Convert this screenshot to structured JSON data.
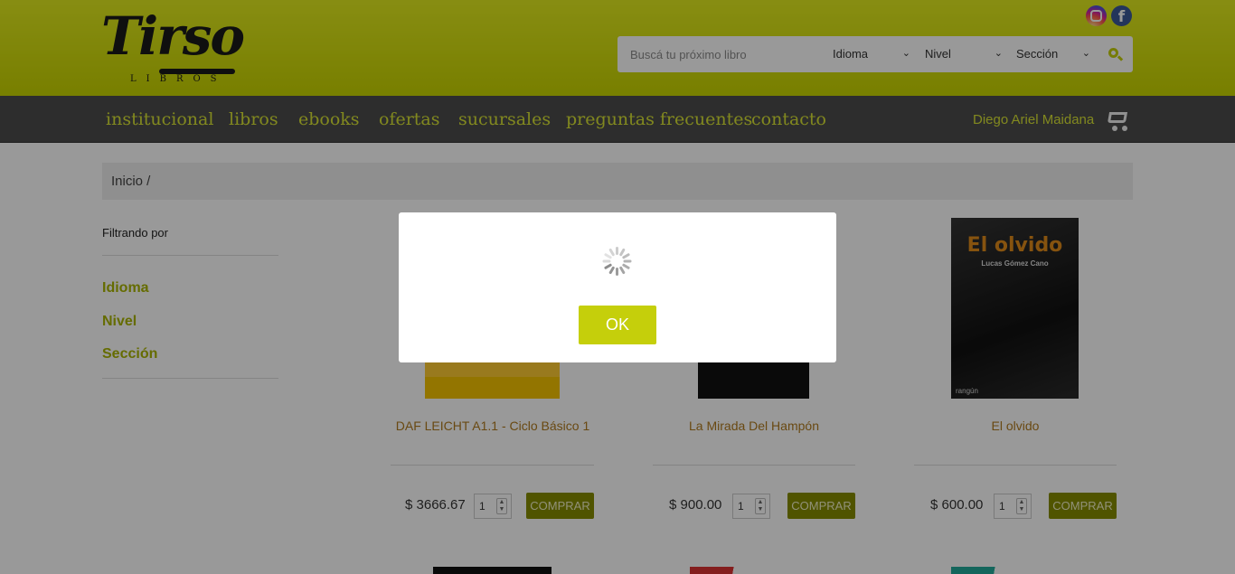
{
  "header": {
    "logo_text": "Tirso",
    "logo_sub": "LIBROS",
    "search": {
      "placeholder": "Buscá tu próximo libro",
      "idioma": "Idioma",
      "nivel": "Nivel",
      "seccion": "Sección"
    }
  },
  "nav": {
    "items": [
      "institucional",
      "libros",
      "ebooks",
      "ofertas",
      "sucursales",
      "preguntas frecuentes",
      "contacto"
    ],
    "user": "Diego Ariel Maidana"
  },
  "breadcrumb": "Inicio  /",
  "filters": {
    "title": "Filtrando por",
    "items": [
      "Idioma",
      "Nivel",
      "Sección"
    ]
  },
  "products": [
    {
      "title": "DAF LEICHT A1.1 - Ciclo Básico 1",
      "price": "$ 3666.67",
      "qty": "1",
      "buy": "COMPRAR"
    },
    {
      "title": "La Mirada Del Hampón",
      "price": "$ 900.00",
      "qty": "1",
      "buy": "COMPRAR"
    },
    {
      "title": "El olvido",
      "price": "$ 600.00",
      "qty": "1",
      "buy": "COMPRAR",
      "cover_title": "El olvido",
      "cover_author": "Lucas Gómez Cano",
      "cover_publisher": "rangún"
    }
  ],
  "modal": {
    "ok": "OK"
  },
  "colors": {
    "accent": "#c5cf0b",
    "nav_bg": "#4c4c4c",
    "link": "#b07a1e"
  }
}
